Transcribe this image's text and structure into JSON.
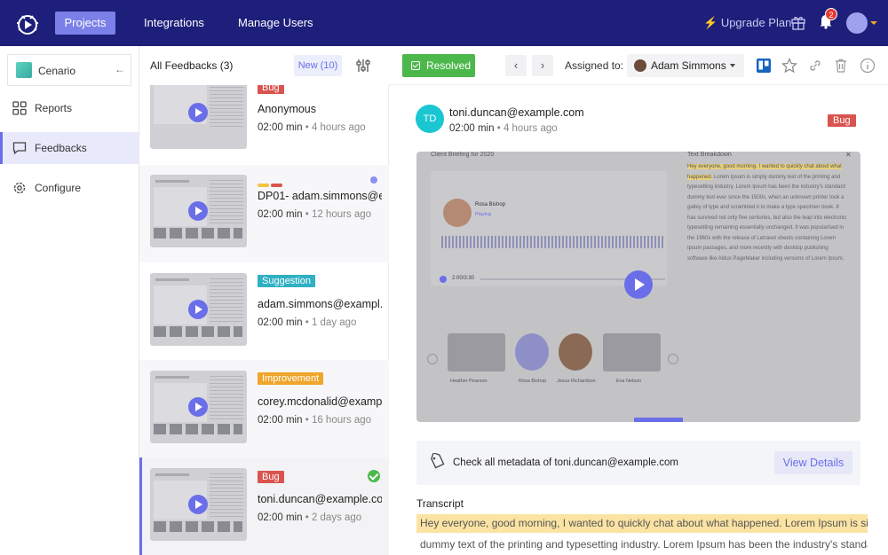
{
  "topbar": {
    "nav": [
      "Projects",
      "Integrations",
      "Manage Users"
    ],
    "upgrade": "Upgrade Plan",
    "notifications": "2",
    "accent": "#1d1f7a"
  },
  "sidebar": {
    "project": "Cenario",
    "items": [
      {
        "label": "Reports",
        "icon": "grid-icon"
      },
      {
        "label": "Feedbacks",
        "icon": "message-icon"
      },
      {
        "label": "Configure",
        "icon": "gear-icon"
      }
    ]
  },
  "feedlist": {
    "title": "All Feedbacks (3)",
    "new_label": "New (10)",
    "cards": [
      {
        "tag": "Bug",
        "tag_color": "#d9534f",
        "email": "Anonymous",
        "duration": "02:00 min",
        "ago": "• 4 hours ago"
      },
      {
        "tag": "",
        "tag_color": "",
        "email": "DP01- adam.simmons@e...",
        "duration": "02:00 min",
        "ago": "• 12 hours ago"
      },
      {
        "tag": "Suggestion",
        "tag_color": "#2fb0c3",
        "email": "adam.simmons@exampl...",
        "duration": "02:00 min",
        "ago": "• 1 day ago"
      },
      {
        "tag": "Improvement",
        "tag_color": "#f0a52b",
        "email": "corey.mcdonalid@examp...",
        "duration": "02:00 min",
        "ago": "• 16 hours ago"
      },
      {
        "tag": "Bug",
        "tag_color": "#d9534f",
        "email": "toni.duncan@example.co...",
        "duration": "02:00 min",
        "ago": "• 2 days ago"
      }
    ]
  },
  "toolbar": {
    "resolved": "Resolved",
    "assigned_label": "Assigned to:",
    "assignee": "Adam Simmons"
  },
  "detail": {
    "initials": "TD",
    "email": "toni.duncan@example.com",
    "duration": "02:00 min",
    "ago": "• 4 hours ago",
    "tag": "Bug",
    "video": {
      "title": "Client Briefing for 2020",
      "breakdown": "Text Breakdown",
      "speaker": "Rosa Bishop",
      "status": "Playing",
      "time": "2:00/3:30",
      "text_highlight": "Hey everyone, good morning. I wanted to quickly chat about what happened.",
      "text_rest": "Lorem Ipsum is simply dummy text of the printing and typesetting industry. Lorem Ipsum has been the industry's standard dummy text ever since the 1500s, when an unknown printer took a galley of type and scrambled it to make a type specimen book. It has survived not only five centuries, but also the leap into electronic typesetting remaining essentially unchanged. It was popularised in the 1960s with the release of Letraset sheets containing Lorem Ipsum passages, and more recently with desktop publishing software like Aldus PageMaker including versions of Lorem Ipsum.",
      "participants": [
        "Heather Pearson",
        "Rosa Bishop",
        "Jesus Richardson",
        "Eva Nelson"
      ]
    },
    "meta_text": "Check all metadata of toni.duncan@example.com",
    "meta_button": "View Details",
    "transcript_title": "Transcript",
    "transcript_line1": "Hey everyone, good morning, I wanted to quickly chat about what happened. Lorem Ipsum is simply",
    "transcript_line2": "dummy text of the printing and typesetting industry. Lorem Ipsum has been the industry's standard"
  }
}
